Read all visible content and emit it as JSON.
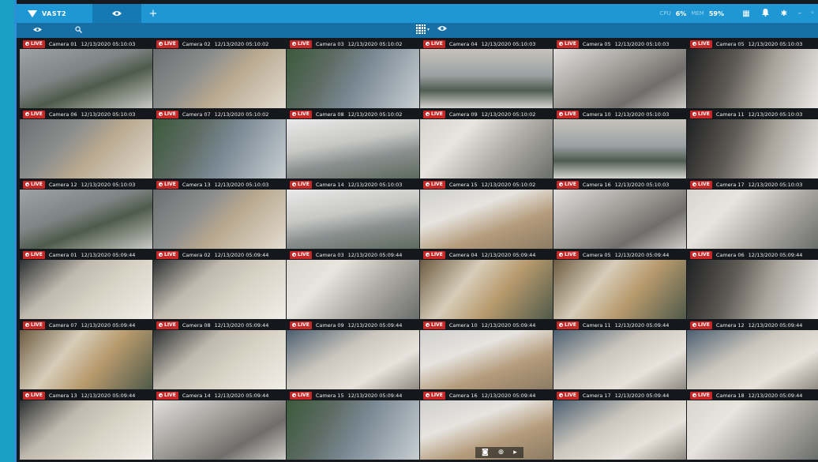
{
  "app": {
    "logo_text": "VAST2",
    "stats": [
      {
        "label": "CPU",
        "value": "6%"
      },
      {
        "label": "MEM",
        "value": "59%"
      }
    ],
    "top_icons": [
      "layout-icon",
      "bell-icon",
      "gear-icon"
    ],
    "accent": "#1e97d4",
    "live_color": "#c62828"
  },
  "subbar": {
    "left_buttons": [
      "camera-icon",
      "search-icon"
    ],
    "layout_caret": "▾"
  },
  "live_label": "LIVE",
  "cameras": [
    {
      "name": "Camera 01",
      "ts": "12/13/2020 05:10:03",
      "scene": "s1"
    },
    {
      "name": "Camera 02",
      "ts": "12/13/2020 05:10:02",
      "scene": "s2"
    },
    {
      "name": "Camera 03",
      "ts": "12/13/2020 05:10:02",
      "scene": "s3"
    },
    {
      "name": "Camera 04",
      "ts": "12/13/2020 05:10:03",
      "scene": "s4"
    },
    {
      "name": "Camera 05",
      "ts": "12/13/2020 05:10:03",
      "scene": "s5"
    },
    {
      "name": "Camera 05",
      "ts": "12/13/2020 05:10:03",
      "scene": "s6"
    },
    {
      "name": "Camera 06",
      "ts": "12/13/2020 05:10:03",
      "scene": "s2"
    },
    {
      "name": "Camera 07",
      "ts": "12/13/2020 05:10:02",
      "scene": "s3"
    },
    {
      "name": "Camera 08",
      "ts": "12/13/2020 05:10:02",
      "scene": "s7"
    },
    {
      "name": "Camera 09",
      "ts": "12/13/2020 05:10:02",
      "scene": "s8"
    },
    {
      "name": "Camera 10",
      "ts": "12/13/2020 05:10:03",
      "scene": "s4"
    },
    {
      "name": "Camera 11",
      "ts": "12/13/2020 05:10:03",
      "scene": "s6"
    },
    {
      "name": "Camera 12",
      "ts": "12/13/2020 05:10:03",
      "scene": "s1"
    },
    {
      "name": "Camera 13",
      "ts": "12/13/2020 05:10:03",
      "scene": "s2"
    },
    {
      "name": "Camera 14",
      "ts": "12/13/2020 05:10:03",
      "scene": "s7"
    },
    {
      "name": "Camera 15",
      "ts": "12/13/2020 05:10:02",
      "scene": "s9"
    },
    {
      "name": "Camera 16",
      "ts": "12/13/2020 05:10:03",
      "scene": "s5"
    },
    {
      "name": "Camera 17",
      "ts": "12/13/2020 05:10:03",
      "scene": "s8"
    },
    {
      "name": "Camera 01",
      "ts": "12/13/2020 05:09:44",
      "scene": "s10"
    },
    {
      "name": "Camera 02",
      "ts": "12/13/2020 05:09:44",
      "scene": "s10"
    },
    {
      "name": "Camera 03",
      "ts": "12/13/2020 05:09:44",
      "scene": "s8"
    },
    {
      "name": "Camera 04",
      "ts": "12/13/2020 05:09:44",
      "scene": "s11"
    },
    {
      "name": "Camera 05",
      "ts": "12/13/2020 05:09:44",
      "scene": "s11"
    },
    {
      "name": "Camera 06",
      "ts": "12/13/2020 05:09:44",
      "scene": "s6"
    },
    {
      "name": "Camera 07",
      "ts": "12/13/2020 05:09:44",
      "scene": "s11"
    },
    {
      "name": "Camera 08",
      "ts": "12/13/2020 05:09:44",
      "scene": "s10"
    },
    {
      "name": "Camera 09",
      "ts": "12/13/2020 05:09:44",
      "scene": "s12"
    },
    {
      "name": "Camera 10",
      "ts": "12/13/2020 05:09:44",
      "scene": "s9"
    },
    {
      "name": "Camera 11",
      "ts": "12/13/2020 05:09:44",
      "scene": "s12",
      "selected": true
    },
    {
      "name": "Camera 12",
      "ts": "12/13/2020 05:09:44",
      "scene": "s12"
    },
    {
      "name": "Camera 13",
      "ts": "12/13/2020 05:09:44",
      "scene": "s10"
    },
    {
      "name": "Camera 14",
      "ts": "12/13/2020 05:09:44",
      "scene": "s5"
    },
    {
      "name": "Camera 15",
      "ts": "12/13/2020 05:09:44",
      "scene": "s3"
    },
    {
      "name": "Camera 16",
      "ts": "12/13/2020 05:09:44",
      "scene": "s9",
      "tools": [
        "snapshot-icon",
        "zoom-icon",
        "play-icon"
      ]
    },
    {
      "name": "Camera 17",
      "ts": "12/13/2020 05:09:44",
      "scene": "s12"
    },
    {
      "name": "Camera 18",
      "ts": "12/13/2020 05:09:44",
      "scene": "s8"
    }
  ]
}
